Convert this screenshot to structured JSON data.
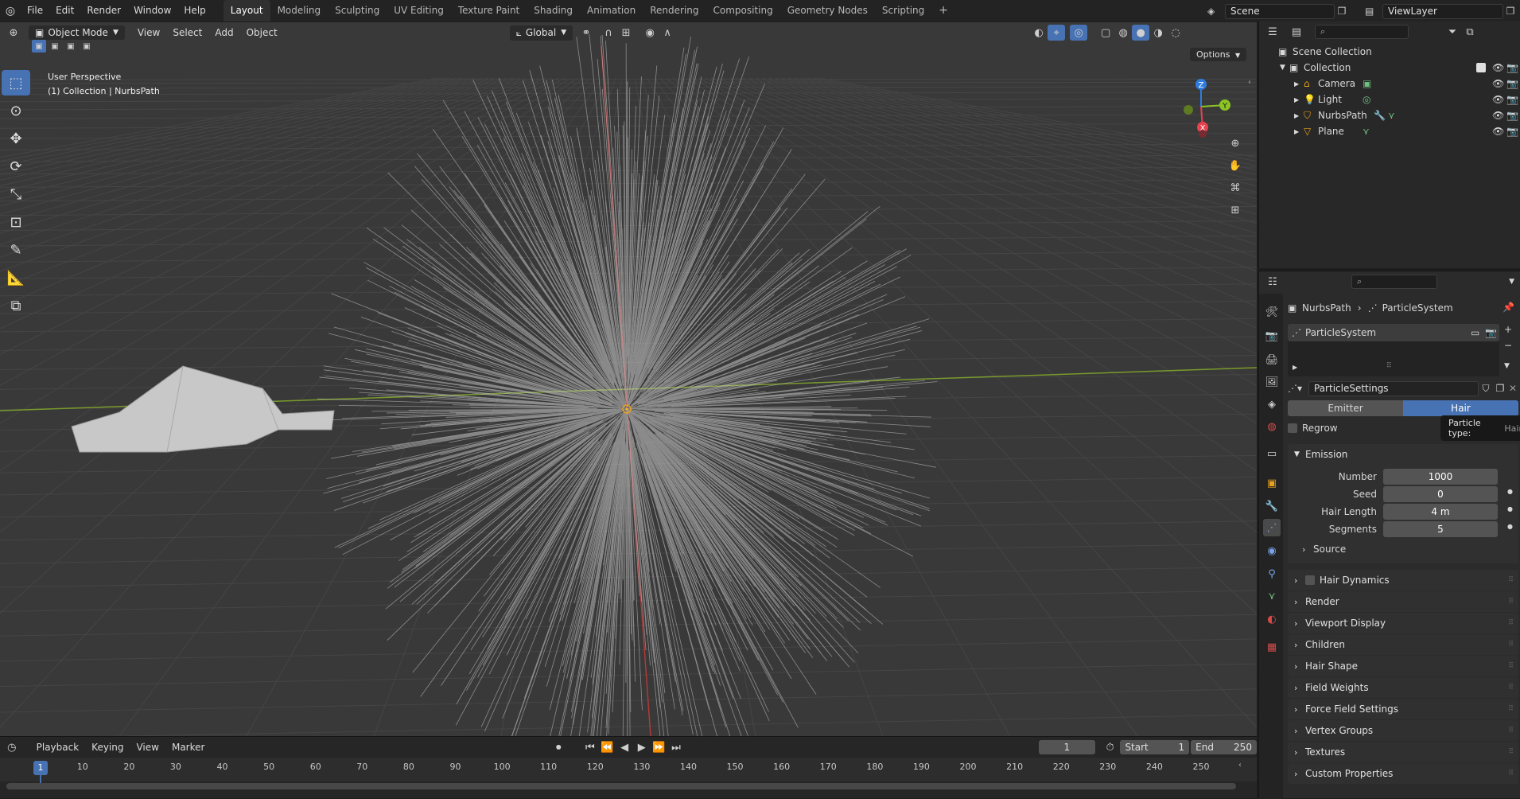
{
  "top_menu": [
    "File",
    "Edit",
    "Render",
    "Window",
    "Help"
  ],
  "workspaces": [
    "Layout",
    "Modeling",
    "Sculpting",
    "UV Editing",
    "Texture Paint",
    "Shading",
    "Animation",
    "Rendering",
    "Compositing",
    "Geometry Nodes",
    "Scripting"
  ],
  "active_workspace": "Layout",
  "scene_name": "Scene",
  "view_layer_name": "ViewLayer",
  "viewport": {
    "mode": "Object Mode",
    "menus": [
      "View",
      "Select",
      "Add",
      "Object"
    ],
    "transform_orientation": "Global",
    "options_label": "Options",
    "overlay_line1": "User Perspective",
    "overlay_line2": "(1) Collection | NurbsPath",
    "gizmo": {
      "z": "Z",
      "y": "Y",
      "x": "X"
    }
  },
  "outliner": {
    "root": "Scene Collection",
    "collection": "Collection",
    "items": [
      "Camera",
      "Light",
      "NurbsPath",
      "Plane"
    ]
  },
  "properties": {
    "breadcrumb_object": "NurbsPath",
    "breadcrumb_system": "ParticleSystem",
    "system_list_item": "ParticleSystem",
    "settings_name": "ParticleSettings",
    "type_emitter": "Emitter",
    "type_hair": "Hair",
    "regrow_label": "Regrow",
    "tooltip_label": "Particle type:",
    "tooltip_value": "Hair",
    "emission_label": "Emission",
    "fields": [
      {
        "label": "Number",
        "value": "1000"
      },
      {
        "label": "Seed",
        "value": "0"
      },
      {
        "label": "Hair Length",
        "value": "4 m"
      },
      {
        "label": "Segments",
        "value": "5"
      }
    ],
    "source_label": "Source",
    "panels": [
      "Hair Dynamics",
      "Render",
      "Viewport Display",
      "Children",
      "Hair Shape",
      "Field Weights",
      "Force Field Settings",
      "Vertex Groups",
      "Textures",
      "Custom Properties"
    ]
  },
  "timeline": {
    "menus": [
      "Playback",
      "Keying",
      "View",
      "Marker"
    ],
    "current_frame": "1",
    "start_label": "Start",
    "start_value": "1",
    "end_label": "End",
    "end_value": "250",
    "ticks": [
      "1",
      "10",
      "20",
      "30",
      "40",
      "50",
      "60",
      "70",
      "80",
      "90",
      "100",
      "110",
      "120",
      "130",
      "140",
      "150",
      "160",
      "170",
      "180",
      "190",
      "200",
      "210",
      "220",
      "230",
      "240",
      "250"
    ]
  },
  "colors": {
    "accent": "#4772b3",
    "x_axis": "#e8424f",
    "y_axis": "#8cc424",
    "z_axis": "#2f7be0"
  }
}
